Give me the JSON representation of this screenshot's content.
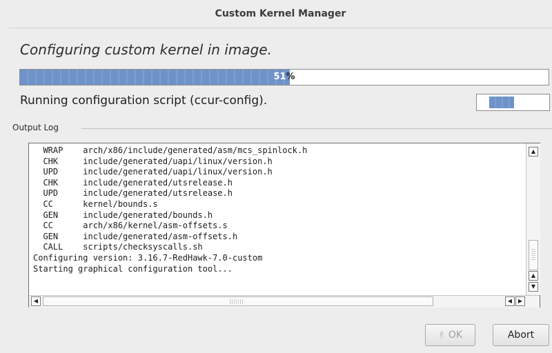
{
  "window": {
    "title": "Custom Kernel Manager"
  },
  "heading": "Configuring custom kernel in image.",
  "progress": {
    "value_percent": 51,
    "text": "51",
    "unit": "%",
    "bar_color": "#6f93c8"
  },
  "status": {
    "text": "Running configuration script (ccur-config)."
  },
  "output_log": {
    "label": "Output Log",
    "text": "  WRAP    arch/x86/include/generated/asm/mcs_spinlock.h\n  CHK     include/generated/uapi/linux/version.h\n  UPD     include/generated/uapi/linux/version.h\n  CHK     include/generated/utsrelease.h\n  UPD     include/generated/utsrelease.h\n  CC      kernel/bounds.s\n  GEN     include/generated/bounds.h\n  CC      arch/x86/kernel/asm-offsets.s\n  GEN     include/generated/asm-offsets.h\n  CALL    scripts/checksyscalls.sh\nConfiguring version: 3.16.7-RedHawk-7.0-custom\nStarting graphical configuration tool...",
    "scroll_up_icon": "triangle-up",
    "scroll_down_icon": "triangle-down",
    "scroll_left_icon": "triangle-left",
    "scroll_right_icon": "triangle-right"
  },
  "buttons": {
    "ok_label": "OK",
    "ok_icon": "thumbs-up-icon",
    "ok_enabled": false,
    "abort_label": "Abort"
  }
}
